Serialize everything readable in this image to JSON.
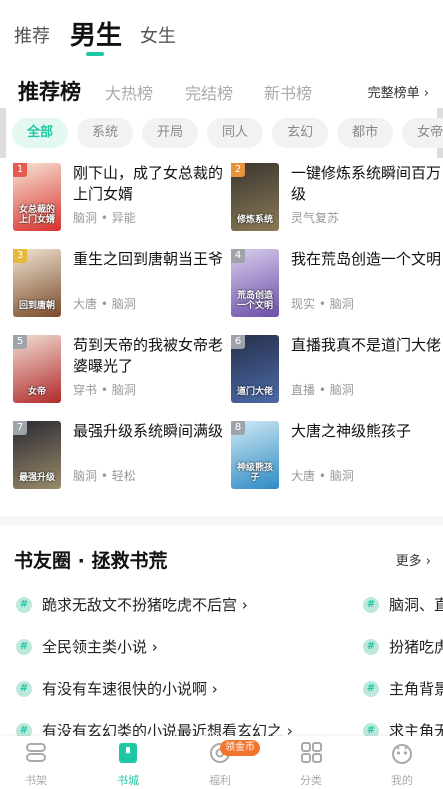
{
  "top_tabs": [
    {
      "label": "推荐",
      "active": false
    },
    {
      "label": "男生",
      "active": true
    },
    {
      "label": "女生",
      "active": false
    }
  ],
  "rank": {
    "tabs": [
      {
        "label": "推荐榜",
        "active": true
      },
      {
        "label": "大热榜",
        "active": false
      },
      {
        "label": "完结榜",
        "active": false
      },
      {
        "label": "新书榜",
        "active": false
      }
    ],
    "all_label": "完整榜单 ›"
  },
  "chips": [
    {
      "label": "全部",
      "active": true
    },
    {
      "label": "系统",
      "active": false
    },
    {
      "label": "开局",
      "active": false
    },
    {
      "label": "同人",
      "active": false
    },
    {
      "label": "玄幻",
      "active": false
    },
    {
      "label": "都市",
      "active": false
    },
    {
      "label": "女帝",
      "active": false
    }
  ],
  "books": [
    {
      "rank": "1",
      "title": "刚下山，成了女总裁的上门女婿",
      "meta": "脑洞 • 异能",
      "cover_colors": [
        "#f7e6d6",
        "#d8302b"
      ],
      "cover_text": "女总裁的上门女婿"
    },
    {
      "rank": "2",
      "title": "一键修炼系统瞬间百万级",
      "meta": "灵气复苏",
      "cover_colors": [
        "#3a3530",
        "#8a7a55"
      ],
      "cover_text": "修炼系统"
    },
    {
      "rank": "3",
      "title": "重生之回到唐朝当王爷",
      "meta": "大唐 • 脑洞",
      "cover_colors": [
        "#efe4d2",
        "#7a4a2a"
      ],
      "cover_text": "回到唐朝"
    },
    {
      "rank": "4",
      "title": "我在荒岛创造一个文明",
      "meta": "现实 • 脑洞",
      "cover_colors": [
        "#d9cdec",
        "#6a4fa8"
      ],
      "cover_text": "荒岛创造一个文明"
    },
    {
      "rank": "5",
      "title": "苟到天帝的我被女帝老婆曝光了",
      "meta": "穿书 • 脑洞",
      "cover_colors": [
        "#f1ded3",
        "#b02a2a"
      ],
      "cover_text": "女帝"
    },
    {
      "rank": "6",
      "title": "直播我真不是道门大佬",
      "meta": "直播 • 脑洞",
      "cover_colors": [
        "#27304a",
        "#4c6aa8"
      ],
      "cover_text": "道门大佬"
    },
    {
      "rank": "7",
      "title": "最强升级系统瞬间满级",
      "meta": "脑洞 • 轻松",
      "cover_colors": [
        "#2b2a33",
        "#9a8a6a"
      ],
      "cover_text": "最强升级"
    },
    {
      "rank": "8",
      "title": "大唐之神级熊孩子",
      "meta": "大唐 • 脑洞",
      "cover_colors": [
        "#cfe9f4",
        "#2c8bc4"
      ],
      "cover_text": "神级熊孩子"
    }
  ],
  "community": {
    "title": "书友圈 · 拯救书荒",
    "more_label": "更多 ›",
    "col1": [
      "跪求无敌文不扮猪吃虎不后宫 ›",
      "全民领主类小说 ›",
      "有没有车速很快的小说啊 ›",
      "有没有玄幻类的小说最近想看玄幻之 ›"
    ],
    "col2": [
      "脑洞、直",
      "扮猪吃虎",
      "主角背景",
      "求主角无"
    ]
  },
  "bottom_nav": [
    {
      "label": "书架",
      "icon": "bookshelf-icon",
      "active": false
    },
    {
      "label": "书城",
      "icon": "bookstore-icon",
      "active": true
    },
    {
      "label": "福利",
      "icon": "welfare-icon",
      "active": false
    },
    {
      "label": "分类",
      "icon": "category-icon",
      "active": false
    },
    {
      "label": "我的",
      "icon": "profile-icon",
      "active": false
    }
  ],
  "coin_badge": "领金币",
  "accent_color": "#1fc8a4"
}
